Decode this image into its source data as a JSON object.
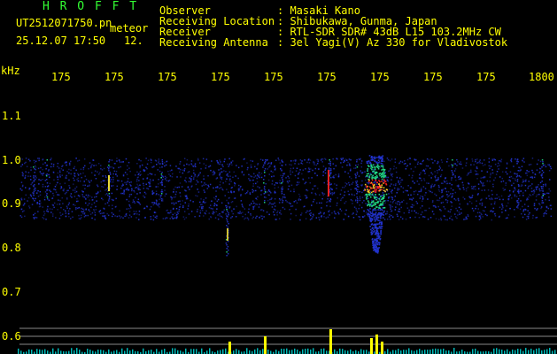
{
  "header": {
    "title": "H R O F F T",
    "filename": "UT2512071750.pn",
    "meteor_label": "meteor",
    "datetime": "25.12.07 17:50",
    "count": "12.",
    "fields": [
      {
        "label": "Observer",
        "value": ": Masaki Kano"
      },
      {
        "label": "Receiving Location",
        "value": ": Shibukawa, Gunma, Japan"
      },
      {
        "label": "Receiver",
        "value": ": RTL-SDR SDR# 43dB L15 103.2MHz CW"
      },
      {
        "label": "Receiving Antenna",
        "value": ": 3el Yagi(V) Az 330 for Vladivostok"
      }
    ]
  },
  "spectrogram": {
    "y_unit": "kHz",
    "x_ticks": [
      "175",
      "175",
      "175",
      "175",
      "175",
      "175",
      "175",
      "175",
      "175",
      "1800"
    ],
    "y_ticks": [
      "1.1",
      "1.0",
      "0.9",
      "0.8",
      "0.7",
      "0.6"
    ],
    "colors": {
      "text_yellow": "#ffff00",
      "text_green": "#33ff33",
      "noise_blue": "#2233cc",
      "echo_green": "#22dd88",
      "echo_red": "#ff2222",
      "baseline_cyan": "#00cccc"
    }
  }
}
